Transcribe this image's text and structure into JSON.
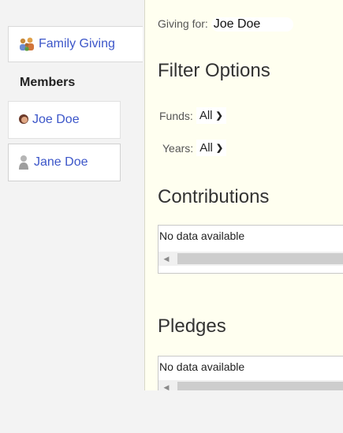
{
  "sidebar": {
    "family_label": "Family Giving",
    "members_heading": "Members",
    "members": [
      {
        "label": "Joe Doe",
        "icon": "person-photo-icon"
      },
      {
        "label": "Jane Doe",
        "icon": "person-placeholder-icon"
      }
    ],
    "family_icon": "family-icon"
  },
  "main": {
    "giving_for_label": "Giving for:",
    "giving_for_name": "Joe Doe",
    "filter_title": "Filter Options",
    "funds_label": "Funds:",
    "funds_value": "All",
    "years_label": "Years:",
    "years_value": "All",
    "contributions_title": "Contributions",
    "contributions_empty": "No data available",
    "pledges_title": "Pledges",
    "pledges_empty": "No data available"
  },
  "colors": {
    "link": "#3c56c9",
    "panel_bg": "#fffff0",
    "page_bg": "#f3f3f3"
  }
}
